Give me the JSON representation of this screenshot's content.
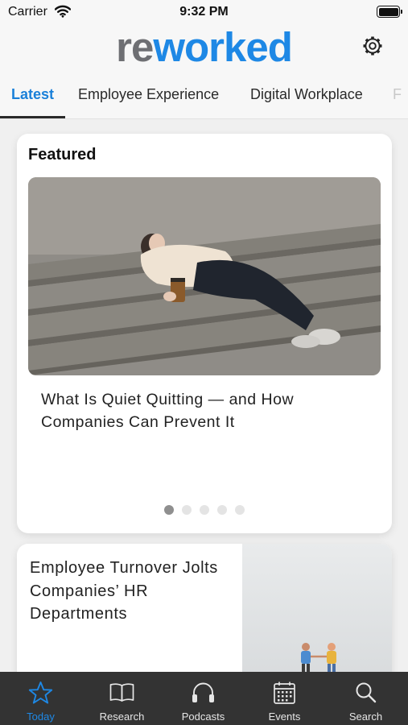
{
  "status_bar": {
    "carrier": "Carrier",
    "time": "9:32 PM",
    "icons": [
      "wifi-icon",
      "battery-icon"
    ]
  },
  "header": {
    "logo_part1": "re",
    "logo_part2": "worked",
    "logo_colors": {
      "re": "#6e6f73",
      "worked": "#1e88e5"
    },
    "settings_icon": "gear-icon"
  },
  "category_tabs": [
    {
      "label": "Latest",
      "active": true
    },
    {
      "label": "Employee Experience",
      "active": false
    },
    {
      "label": "Digital Workplace",
      "active": false
    },
    {
      "label": "F",
      "active": false
    }
  ],
  "featured": {
    "label": "Featured",
    "title": "What Is Quiet Quitting — and How Companies Can Prevent It",
    "carousel": {
      "pages": 5,
      "current": 1
    }
  },
  "articles": [
    {
      "title": "Employee Turnover Jolts Companies’ HR Departments"
    }
  ],
  "tab_bar": {
    "accent_color": "#1e88e5",
    "items": [
      {
        "label": "Today",
        "icon": "star-icon",
        "active": true
      },
      {
        "label": "Research",
        "icon": "book-icon",
        "active": false
      },
      {
        "label": "Podcasts",
        "icon": "headphones-icon",
        "active": false
      },
      {
        "label": "Events",
        "icon": "calendar-icon",
        "active": false
      },
      {
        "label": "Search",
        "icon": "search-icon",
        "active": false
      }
    ]
  }
}
